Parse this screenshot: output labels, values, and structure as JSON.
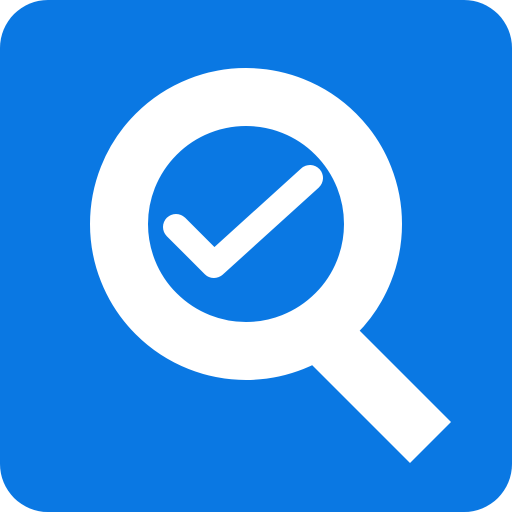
{
  "icon": {
    "name": "search-check-icon",
    "colors": {
      "background": "#0A78E3",
      "foreground": "#FFFFFF"
    }
  }
}
